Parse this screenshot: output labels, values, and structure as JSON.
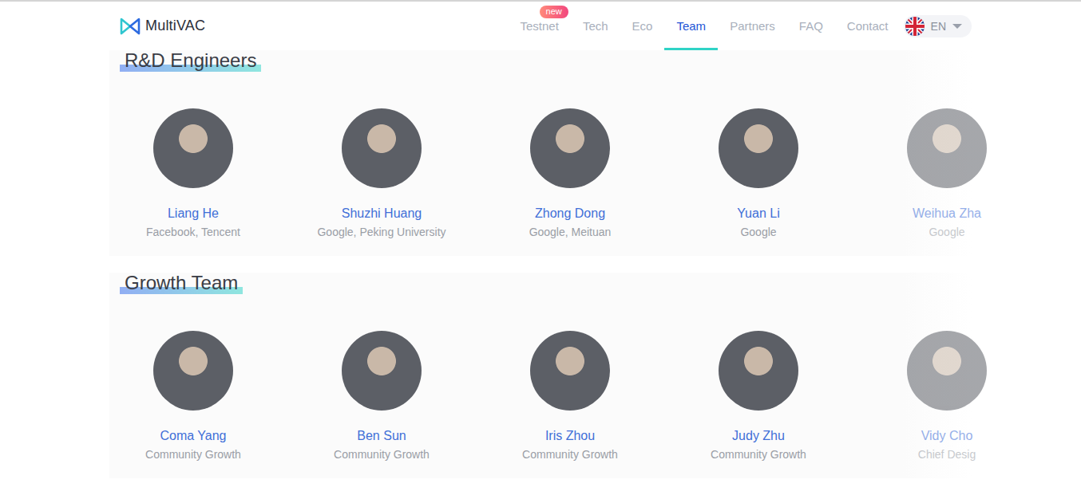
{
  "logo": {
    "text": "MultiVAC"
  },
  "nav": [
    {
      "label": "Testnet",
      "selected": false,
      "badge": "new"
    },
    {
      "label": "Tech",
      "selected": false
    },
    {
      "label": "Eco",
      "selected": false
    },
    {
      "label": "Team",
      "selected": true
    },
    {
      "label": "Partners",
      "selected": false
    },
    {
      "label": "FAQ",
      "selected": false
    },
    {
      "label": "Contact",
      "selected": false
    }
  ],
  "language": {
    "label": "EN"
  },
  "sections": [
    {
      "title": "R&D Engineers",
      "members": [
        {
          "name": "Liang He",
          "subtitle": "Facebook, Tencent"
        },
        {
          "name": "Shuzhi Huang",
          "subtitle": "Google, Peking University"
        },
        {
          "name": "Zhong Dong",
          "subtitle": "Google, Meituan"
        },
        {
          "name": "Yuan Li",
          "subtitle": "Google"
        },
        {
          "name": "Weihua Zha",
          "subtitle": "Google"
        }
      ]
    },
    {
      "title": "Growth Team",
      "members": [
        {
          "name": "Coma Yang",
          "subtitle": "Community Growth"
        },
        {
          "name": "Ben Sun",
          "subtitle": "Community Growth"
        },
        {
          "name": "Iris Zhou",
          "subtitle": "Community Growth"
        },
        {
          "name": "Judy Zhu",
          "subtitle": "Community Growth"
        },
        {
          "name": "Vidy Cho",
          "subtitle": "Chief Desig"
        }
      ]
    }
  ]
}
